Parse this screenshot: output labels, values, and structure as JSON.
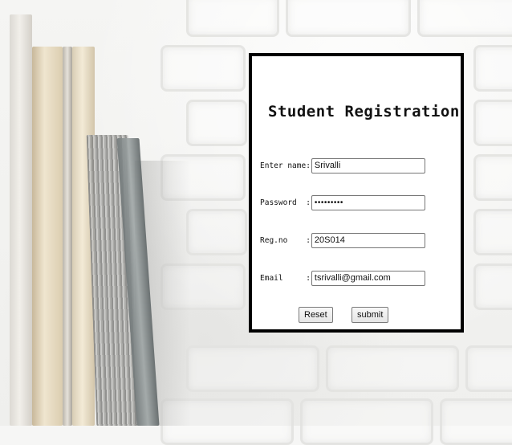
{
  "form": {
    "title": "Student Registration",
    "fields": [
      {
        "label": "Enter name:",
        "value": "Srivalli",
        "type": "text"
      },
      {
        "label": "Password  :",
        "value": "•••••••••",
        "type": "password"
      },
      {
        "label": "Reg.no    :",
        "value": "20S014",
        "type": "text"
      },
      {
        "label": "Email     :",
        "value": "tsrivalli@gmail.com",
        "type": "text"
      }
    ],
    "buttons": {
      "reset_label": "Reset",
      "submit_label": "submit"
    }
  },
  "colors": {
    "panel_border": "#000000",
    "panel_background": "#ffffff",
    "page_background": "#f6f6f5"
  }
}
